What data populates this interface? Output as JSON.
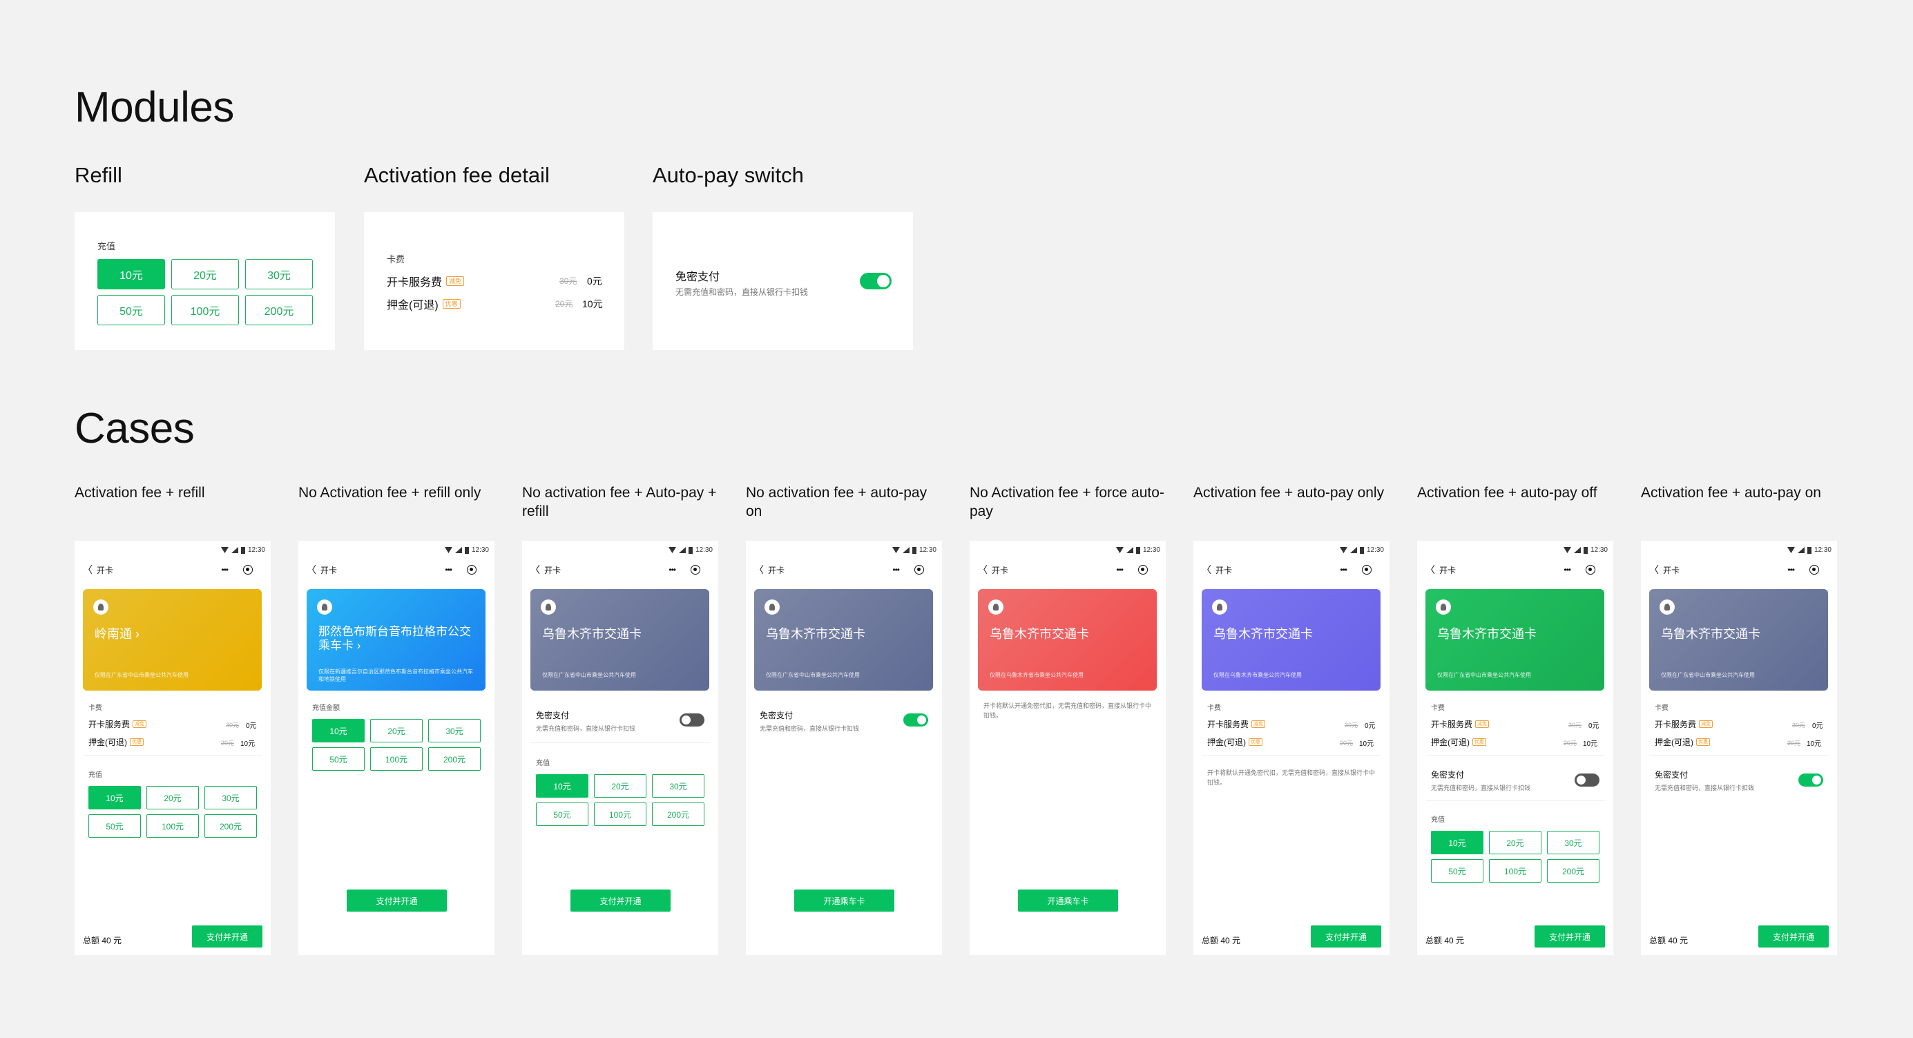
{
  "modules_title": "Modules",
  "cases_title": "Cases",
  "modules": {
    "refill": {
      "heading": "Refill",
      "label": "充值",
      "options": [
        "10元",
        "20元",
        "30元",
        "50元",
        "100元",
        "200元"
      ]
    },
    "fee": {
      "heading": "Activation fee detail",
      "label": "卡费",
      "rows": [
        {
          "name": "开卡服务费",
          "tag": "减免",
          "old": "30元",
          "value": "0元"
        },
        {
          "name": "押金(可退)",
          "tag": "优惠",
          "old": "20元",
          "value": "10元"
        }
      ]
    },
    "autopay": {
      "heading": "Auto-pay switch",
      "title": "免密支付",
      "desc": "无需充值和密码，直接从银行卡扣钱"
    }
  },
  "phone_common": {
    "time": "12:30",
    "nav_title": "开卡",
    "back": "〈",
    "dots": "•••",
    "refill_label": "充值",
    "refill_label_alt": "充值金额",
    "fee_label": "卡费",
    "auto_title": "免密支付",
    "auto_desc": "无需充值和密码，直接从银行卡扣钱",
    "total": "总额 40 元",
    "pay_btn": "支付并开通",
    "open_btn": "开通乘车卡"
  },
  "cases": [
    {
      "title": "Activation fee + refill",
      "card_name": "岭南通 ›",
      "card_desc": "仅限在广东省中山市乘坐公共汽车使用"
    },
    {
      "title": "No Activation fee + refill only",
      "card_name": "那然色布斯台音布拉格市公交乘车卡 ›",
      "card_desc": "仅限在新疆维吾尔自治区那然色布斯台音布拉格市乘坐公共汽车和地铁使用"
    },
    {
      "title": "No activation fee + Auto-pay + refill",
      "card_name": "乌鲁木齐市交通卡",
      "card_desc": "仅限在广东省中山市乘坐公共汽车使用"
    },
    {
      "title": "No activation fee + auto-pay on",
      "card_name": "乌鲁木齐市交通卡",
      "card_desc": "仅限在广东省中山市乘坐公共汽车使用"
    },
    {
      "title": "No Activation fee + force auto-pay",
      "card_name": "乌鲁木齐市交通卡",
      "card_desc": "仅限在乌鲁木齐省市乘坐公共汽车使用",
      "note": "开卡将默认开通免密代扣，无需充值和密码，直接从银行卡中扣钱。"
    },
    {
      "title": "Activation fee + auto-pay only",
      "card_name": "乌鲁木齐市交通卡",
      "card_desc": "仅限在乌鲁木齐市乘坐公共汽车使用",
      "note": "开卡将默认开通免密代扣，无需充值和密码，直接从银行卡中扣钱。"
    },
    {
      "title": "Activation fee + auto-pay off",
      "card_name": "乌鲁木齐市交通卡",
      "card_desc": "仅限在广东省中山市乘坐公共汽车使用"
    },
    {
      "title": "Activation fee + auto-pay on",
      "card_name": "乌鲁木齐市交通卡",
      "card_desc": "仅限在广东省中山市乘坐公共汽车使用"
    }
  ]
}
